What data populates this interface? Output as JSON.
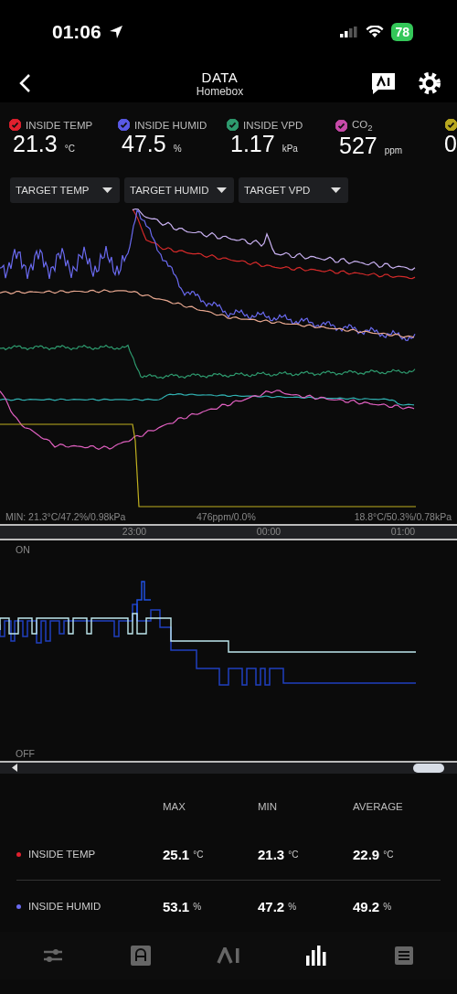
{
  "status_bar": {
    "time": "01:06",
    "battery": "78"
  },
  "header": {
    "title": "DATA",
    "subtitle": "Homebox"
  },
  "metrics": [
    {
      "label": "INSIDE TEMP",
      "value": "21.3",
      "unit": "°C",
      "color": "#e0202e",
      "checked": true
    },
    {
      "label": "INSIDE HUMID",
      "value": "47.5",
      "unit": "%",
      "color": "#5a5ae6",
      "checked": true
    },
    {
      "label": "INSIDE VPD",
      "value": "1.17",
      "unit": "kPa",
      "color": "#2e9a6e",
      "checked": true
    },
    {
      "label": "CO$_{2}$",
      "value": "527",
      "unit": "ppm",
      "color": "#c64aa8",
      "checked": true
    },
    {
      "value": "0",
      "color": "#b8a820",
      "checked": true
    }
  ],
  "filters": [
    {
      "label": "TARGET TEMP"
    },
    {
      "label": "TARGET HUMID"
    },
    {
      "label": "TARGET VPD"
    }
  ],
  "chart": {
    "min_label": "MIN: 21.3°C/47.2%/0.98kPa",
    "mid_label": "476ppm/0.0%",
    "right_label": "18.8°C/50.3%/0.78kPa",
    "time_labels": [
      "23:00",
      "00:00",
      "01:00"
    ]
  },
  "switch_chart": {
    "on_label": "ON",
    "off_label": "OFF"
  },
  "stats": {
    "columns": [
      "MAX",
      "MIN",
      "AVERAGE"
    ],
    "rows": [
      {
        "name": "INSIDE TEMP",
        "color": "#e0202e",
        "values": [
          {
            "value": "25.1",
            "unit": "°C"
          },
          {
            "value": "21.3",
            "unit": "°C"
          },
          {
            "value": "22.9",
            "unit": "°C"
          }
        ]
      },
      {
        "name": "INSIDE HUMID",
        "color": "#6a6af0",
        "values": [
          {
            "value": "53.1",
            "unit": "%"
          },
          {
            "value": "47.2",
            "unit": "%"
          },
          {
            "value": "49.2",
            "unit": "%"
          }
        ]
      }
    ]
  },
  "tab_bar": [
    {
      "kind": "sliders",
      "selected": false
    },
    {
      "kind": "device",
      "selected": false
    },
    {
      "kind": "ai",
      "selected": false
    },
    {
      "kind": "chart",
      "selected": true
    },
    {
      "kind": "list",
      "selected": false
    }
  ]
}
